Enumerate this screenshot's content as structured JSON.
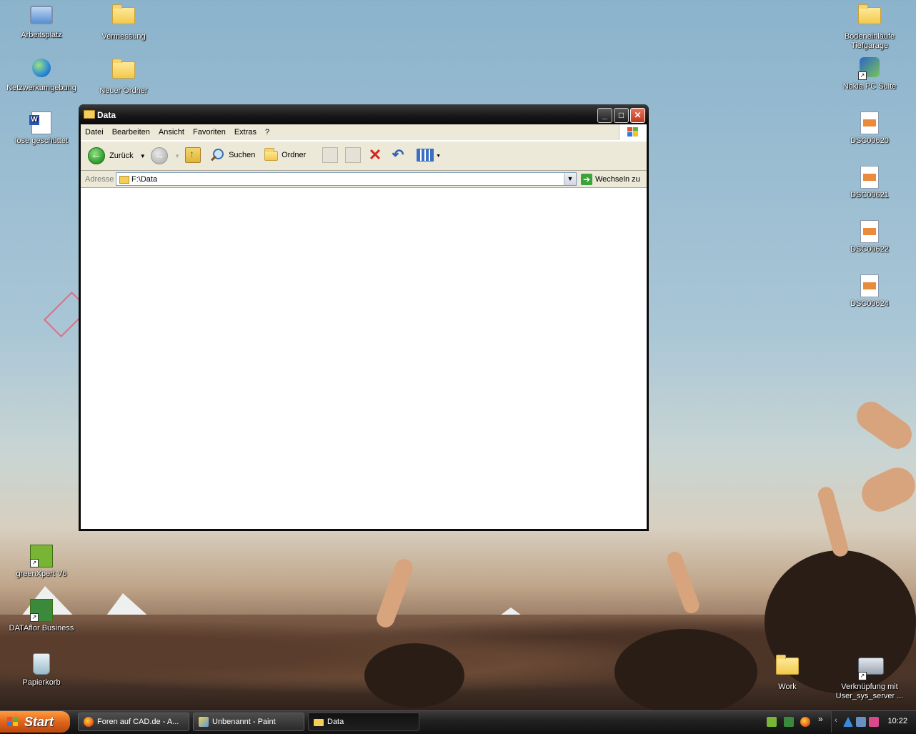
{
  "desktop": {
    "icons_left": [
      {
        "label": "Arbeitsplatz",
        "icon": "my-computer-icon"
      },
      {
        "label": "Netzwerkumgebung",
        "icon": "network-places-icon"
      },
      {
        "label": "lose geschüttet",
        "icon": "word-document-icon"
      },
      {
        "label": "greenXpert V6",
        "icon": "greenxpert-shortcut-icon"
      },
      {
        "label": "DATAflor Business",
        "icon": "dataflor-shortcut-icon"
      },
      {
        "label": "Papierkorb",
        "icon": "recycle-bin-icon"
      }
    ],
    "icons_second_column": [
      {
        "label": "Vermessung",
        "icon": "folder-icon"
      },
      {
        "label": "Neuer Ordner",
        "icon": "folder-icon"
      }
    ],
    "icons_right": [
      {
        "label": "Bodeneinläufe Tiefgarage",
        "icon": "folder-icon"
      },
      {
        "label": "Nokia PC Suite",
        "icon": "nokia-pc-suite-shortcut-icon"
      },
      {
        "label": "DSC00620",
        "icon": "image-file-icon"
      },
      {
        "label": "DSC00621",
        "icon": "image-file-icon"
      },
      {
        "label": "DSC00622",
        "icon": "image-file-icon"
      },
      {
        "label": "DSC00624",
        "icon": "image-file-icon"
      }
    ],
    "icons_bottom_right": [
      {
        "label": "Work",
        "icon": "folder-icon"
      },
      {
        "label": "Verknüpfung mit User_sys_server ...",
        "icon": "network-drive-shortcut-icon"
      }
    ]
  },
  "window": {
    "title": "Data",
    "menu": [
      "Datei",
      "Bearbeiten",
      "Ansicht",
      "Favoriten",
      "Extras",
      "?"
    ],
    "toolbar": {
      "back_label": "Zurück",
      "search_label": "Suchen",
      "folders_label": "Ordner"
    },
    "address": {
      "label": "Adresse",
      "value": "F:\\Data",
      "go_label": "Wechseln zu"
    }
  },
  "taskbar": {
    "start_label": "Start",
    "buttons": [
      {
        "label": "Foren auf CAD.de - A...",
        "active": false
      },
      {
        "label": "Unbenannt - Paint",
        "active": false
      },
      {
        "label": "Data",
        "active": true
      }
    ],
    "chevron": "»",
    "clock": "10:22"
  },
  "colors": {
    "title_bar": "#161616",
    "start_button": "#e0651a",
    "close_button": "#c0361c",
    "toolbar_bg": "#ece9d8"
  }
}
